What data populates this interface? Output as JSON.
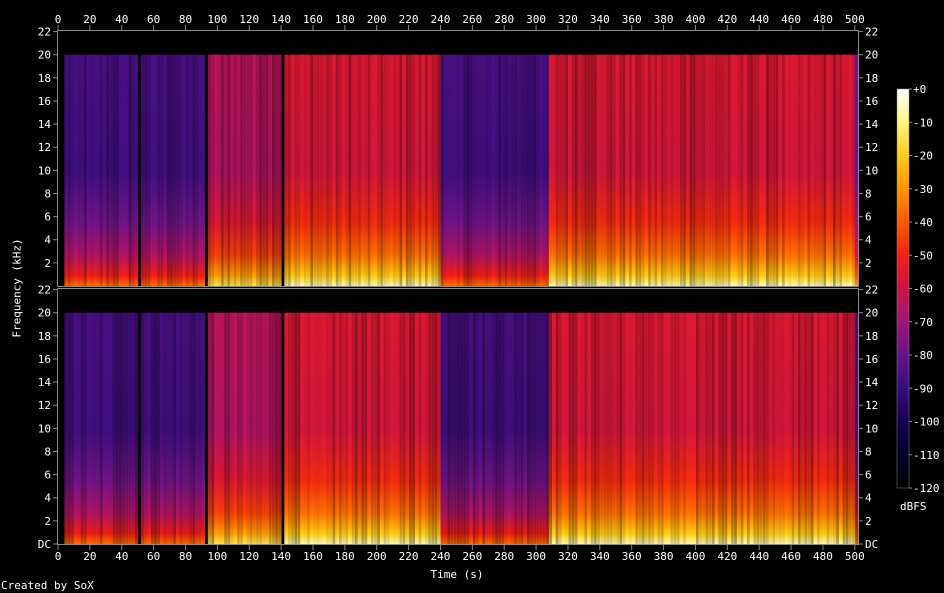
{
  "chart_data": {
    "type": "heatmap",
    "xlabel": "Time (s)",
    "ylabel": "Frequency (kHz)",
    "colorbar_label": "dBFS",
    "credit": "Created by SoX",
    "x_ticks": [
      "0",
      "20",
      "40",
      "60",
      "80",
      "100",
      "120",
      "140",
      "160",
      "180",
      "200",
      "220",
      "240",
      "260",
      "280",
      "300",
      "320",
      "340",
      "360",
      "380",
      "400",
      "420",
      "440",
      "460",
      "480",
      "500"
    ],
    "x_range": [
      0,
      502
    ],
    "y_ticks": [
      "DC",
      "2",
      "4",
      "6",
      "8",
      "10",
      "12",
      "14",
      "16",
      "18",
      "20",
      "22"
    ],
    "y_range_khz": [
      0,
      22.05
    ],
    "channels": 2,
    "colorbar_ticks": [
      "+0",
      "-10",
      "-20",
      "-30",
      "-40",
      "-50",
      "-60",
      "-70",
      "-80",
      "-90",
      "-100",
      "-110",
      "-120"
    ],
    "colorbar_range_dbfs": [
      -120,
      0
    ],
    "content_cutoff_khz": 20,
    "segments": [
      {
        "start": 0,
        "end": 3,
        "level": "silence"
      },
      {
        "start": 3,
        "end": 49,
        "level": "quiet"
      },
      {
        "start": 49,
        "end": 51,
        "level": "silence"
      },
      {
        "start": 51,
        "end": 91,
        "level": "quiet"
      },
      {
        "start": 91,
        "end": 93,
        "level": "silence"
      },
      {
        "start": 93,
        "end": 140,
        "level": "medium"
      },
      {
        "start": 140,
        "end": 142,
        "level": "silence"
      },
      {
        "start": 142,
        "end": 239,
        "level": "loud"
      },
      {
        "start": 239,
        "end": 307,
        "level": "quiet"
      },
      {
        "start": 307,
        "end": 500,
        "level": "loud"
      },
      {
        "start": 500,
        "end": 502,
        "level": "fade"
      }
    ],
    "colors": {
      "background": "#000000",
      "frame": "#8a8a8a",
      "text": "#ffffff"
    }
  }
}
